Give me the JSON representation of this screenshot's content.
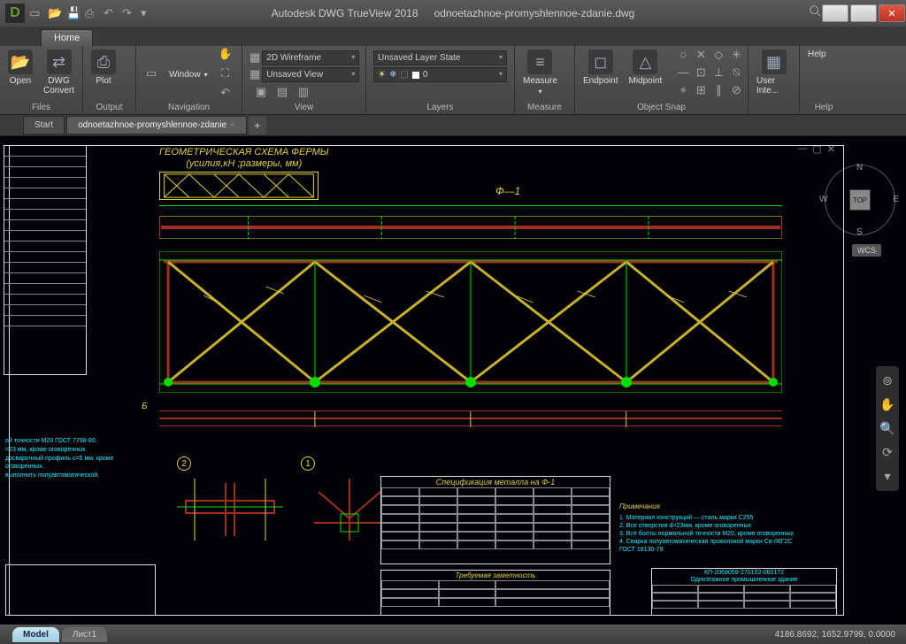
{
  "titlebar": {
    "app": "Autodesk DWG TrueView 2018",
    "file": "odnoetazhnoe-promyshlennoe-zdanie.dwg"
  },
  "ribbon": {
    "home": "Home",
    "open": "Open",
    "convert": "DWG\nConvert",
    "plot": "Plot",
    "files": "Files",
    "output": "Output",
    "window": "Window",
    "navigation": "Navigation",
    "vs_wire": "2D Wireframe",
    "vs_unsaved": "Unsaved View",
    "view": "View",
    "layer_state": "Unsaved Layer State",
    "layers": "Layers",
    "measure": "Measure",
    "measure_panel": "Measure",
    "endpoint": "Endpoint",
    "midpoint": "Midpoint",
    "osnap": "Object Snap",
    "userint": "User Inte...",
    "help": "Help",
    "help_panel": "Help"
  },
  "doctabs": {
    "start": "Start",
    "file": "odnoetazhnoe-promyshlennoe-zdanie"
  },
  "viewcube": {
    "top": "TOP",
    "n": "N",
    "s": "S",
    "e": "E",
    "w": "W"
  },
  "wcs": "WCS",
  "drawing": {
    "title1": "ГЕОМЕТРИЧЕСКАЯ СХЕМА ФЕРМЫ",
    "title2": "(усилия,кН ;размеры, мм)",
    "f1": "Ф—1",
    "axisA": "Б",
    "spec_title": "Спецификация металла на Ф-1",
    "notes_title": "Примечания",
    "note1": "1. Материал конструкций — сталь марки С255",
    "note2": "2. Все отверстия d=23мм, кроме оговоренных",
    "note3": "3. Все болты нормальной точности М20, кроме оговоренных",
    "note4": "4. Сварка полуавтоматическая проволокой марки Св-08Г2С",
    "note5": "ГОСТ 18130-79",
    "tb_code": "КП-2068059-270102-060172",
    "tb_name": "Одноэтажное промышленное здание",
    "req_title": "Требуемая заметность",
    "d1": "1",
    "d2": "2"
  },
  "side_notes": [
    "ой точности М20 ГОСТ 7798-80.",
    "=23 мм, кроме оговоренных.",
    "досварочный профиль с=5 мм, кроме оговоренных.",
    "выполнить полуавтоматической."
  ],
  "status": {
    "model": "Model",
    "layout": "Лист1",
    "coords": "4186.8692, 1652.9799, 0.0000"
  }
}
